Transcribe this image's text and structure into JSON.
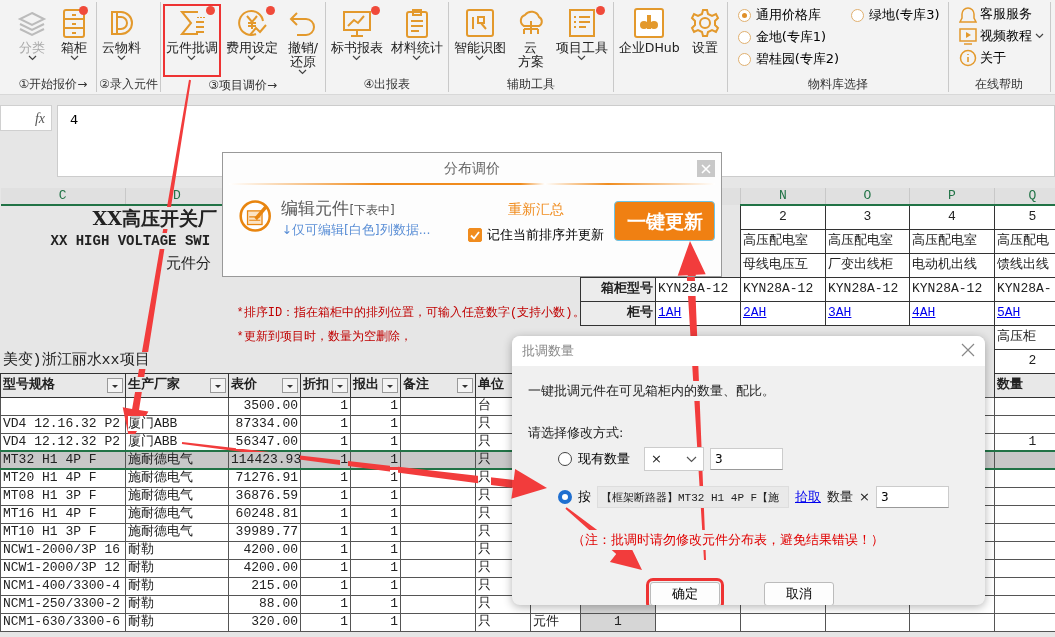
{
  "ribbon": {
    "groups": [
      {
        "kind": "buttons",
        "label": "①开始报价→",
        "buttons": [
          {
            "label": "分类",
            "menu": true,
            "notification": false,
            "disabled": true,
            "highlighted": false
          },
          {
            "label": "箱柜",
            "menu": true,
            "notification": true,
            "disabled": false,
            "highlighted": false
          }
        ]
      },
      {
        "kind": "buttons",
        "label": "②录入元件",
        "buttons": [
          {
            "label": "云物料",
            "menu": true,
            "notification": false,
            "disabled": false,
            "highlighted": false
          }
        ]
      },
      {
        "kind": "buttons",
        "label": "③项目调价→",
        "buttons": [
          {
            "label": "元件批调",
            "menu": true,
            "notification": true,
            "disabled": false,
            "highlighted": true
          },
          {
            "label": "费用设定",
            "menu": true,
            "notification": true,
            "disabled": false,
            "highlighted": false
          },
          {
            "lines": [
              "撤销/",
              "还原"
            ],
            "menu": true,
            "notification": false,
            "disabled": false,
            "highlighted": false
          }
        ]
      },
      {
        "kind": "buttons",
        "label": "④出报表",
        "buttons": [
          {
            "label": "标书报表",
            "menu": true,
            "notification": true,
            "disabled": false,
            "highlighted": false
          },
          {
            "label": "材料统计",
            "menu": true,
            "notification": false,
            "disabled": false,
            "highlighted": false
          }
        ]
      },
      {
        "kind": "buttons",
        "label": "辅助工具",
        "buttons": [
          {
            "label": "智能识图",
            "menu": true,
            "notification": false,
            "disabled": false,
            "highlighted": false
          },
          {
            "lines": [
              "云",
              "方案"
            ],
            "menu": false,
            "notification": false,
            "disabled": false,
            "highlighted": false
          },
          {
            "label": "项目工具",
            "menu": true,
            "notification": true,
            "disabled": false,
            "highlighted": false
          }
        ]
      },
      {
        "kind": "buttons",
        "buttons": [
          {
            "label": "企业DHub",
            "menu": false,
            "notification": false,
            "disabled": false,
            "highlighted": false
          },
          {
            "label": "设置",
            "menu": false,
            "notification": false,
            "disabled": false,
            "highlighted": false
          }
        ]
      },
      {
        "kind": "radios",
        "label": "物料库选择",
        "options": [
          {
            "label": "通用价格库",
            "selected": true
          },
          {
            "label": "金地(专库1)",
            "selected": false
          },
          {
            "label": "碧桂园(专库2)",
            "selected": false
          },
          {
            "label": "绿地(专库3)",
            "selected": false
          }
        ]
      },
      {
        "kind": "links",
        "label": "在线帮助",
        "links": [
          {
            "label": "客服服务",
            "menu": false
          },
          {
            "label": "视频教程",
            "menu": true
          },
          {
            "label": "关于",
            "menu": false
          }
        ]
      }
    ]
  },
  "formula_bar": {
    "function_label": "fx",
    "value": "4"
  },
  "sheet": {
    "column_letters": [
      {
        "letter": "C",
        "selected": true
      },
      {
        "letter": "D",
        "selected": true
      },
      {
        "letter": "N",
        "selected": true
      },
      {
        "letter": "O",
        "selected": true
      },
      {
        "letter": "P",
        "selected": true
      },
      {
        "letter": "Q",
        "selected": true
      }
    ],
    "rows": [
      {
        "kind": "index",
        "banner": {
          "kind": "heading",
          "text": "XX高压开关厂"
        },
        "cells": [
          null,
          null,
          null,
          null,
          null,
          null,
          null,
          null,
          null,
          null,
          "2",
          "3",
          "4",
          "5"
        ]
      },
      {
        "kind": "text",
        "banner": {
          "kind": "subheading",
          "text": "XX HIGH VOLTAGE SWI"
        },
        "cells": [
          null,
          null,
          null,
          null,
          null,
          null,
          null,
          null,
          null,
          null,
          "高压配电室",
          "高压配电室",
          "高压配电室",
          "高压配电"
        ]
      },
      {
        "kind": "text",
        "banner": {
          "kind": "caption",
          "text": "元件分"
        },
        "cells": [
          null,
          null,
          null,
          null,
          null,
          null,
          null,
          null,
          null,
          null,
          "母线电压互",
          "厂变出线柜",
          "电动机出线",
          "馈线出线"
        ]
      },
      {
        "kind": "text",
        "cells": [
          null,
          null,
          null,
          null,
          null,
          null,
          null,
          null,
          "箱柜型号",
          "KYN28A-12",
          "KYN28A-12",
          "KYN28A-12",
          "KYN28A-12",
          "KYN28A-"
        ]
      },
      {
        "kind": "link",
        "banner": {
          "kind": "note",
          "text": "*排序ID：指在箱柜中的排列位置，可输入任意数字(支持小数)。"
        },
        "cells": [
          null,
          null,
          null,
          null,
          null,
          null,
          null,
          null,
          "柜号",
          "1AH",
          "2AH",
          "3AH",
          "4AH",
          "5AH"
        ]
      },
      {
        "kind": "text",
        "banner": {
          "kind": "note",
          "text": "*更新到项目时，数量为空删除，"
        },
        "cells": [
          null,
          null,
          null,
          null,
          null,
          null,
          null,
          null,
          null,
          null,
          null,
          null,
          null,
          "高压柜"
        ]
      },
      {
        "kind": "index",
        "banner": {
          "kind": "project",
          "text": "美变)浙江丽水xx项目"
        },
        "cells": [
          null,
          null,
          null,
          null,
          null,
          null,
          null,
          null,
          null,
          null,
          null,
          null,
          null,
          "2"
        ]
      },
      {
        "kind": "header",
        "filters": [
          true,
          true,
          true,
          true,
          true,
          true
        ],
        "cells": [
          "型号规格",
          "生产厂家",
          "表价",
          "折扣",
          "报出",
          "备注",
          "单位",
          null,
          null,
          null,
          null,
          null,
          null,
          "数量"
        ]
      },
      {
        "kind": "item",
        "selected": false,
        "cells": [
          null,
          null,
          "3500.00",
          "1",
          "1",
          null,
          "台",
          null,
          null,
          null,
          null,
          null,
          null,
          null
        ]
      },
      {
        "kind": "item",
        "selected": false,
        "cells": [
          "VD4 12.16.32 P2",
          "厦门ABB",
          "87334.00",
          "1",
          "1",
          null,
          "只",
          null,
          null,
          null,
          null,
          null,
          null,
          null
        ]
      },
      {
        "kind": "item",
        "selected": false,
        "cells": [
          "VD4 12.12.32 P2",
          "厦门ABB",
          "56347.00",
          "1",
          "1",
          null,
          "只",
          null,
          null,
          null,
          null,
          null,
          null,
          "1"
        ]
      },
      {
        "kind": "item",
        "selected": true,
        "cells": [
          "MT32 H1 4P F",
          "施耐德电气",
          "114423.93",
          "1",
          "1",
          null,
          "只",
          null,
          null,
          null,
          null,
          null,
          null,
          null
        ]
      },
      {
        "kind": "item",
        "selected": false,
        "cells": [
          "MT20 H1 4P F",
          "施耐德电气",
          "71276.91",
          "1",
          "1",
          null,
          "只",
          null,
          null,
          null,
          null,
          null,
          null,
          null
        ]
      },
      {
        "kind": "item",
        "selected": false,
        "cells": [
          "MT08 H1 3P F",
          "施耐德电气",
          "36876.59",
          "1",
          "1",
          null,
          "只",
          null,
          null,
          null,
          null,
          null,
          null,
          null
        ]
      },
      {
        "kind": "item",
        "selected": false,
        "cells": [
          "MT16 H1 4P F",
          "施耐德电气",
          "60248.81",
          "1",
          "1",
          null,
          "只",
          null,
          null,
          null,
          null,
          null,
          null,
          null
        ]
      },
      {
        "kind": "item",
        "selected": false,
        "cells": [
          "MT10 H1 3P F",
          "施耐德电气",
          "39989.77",
          "1",
          "1",
          null,
          "只",
          null,
          null,
          null,
          null,
          null,
          null,
          null
        ]
      },
      {
        "kind": "item",
        "selected": false,
        "cells": [
          "NCW1-2000/3P 16",
          "耐勒",
          "4200.00",
          "1",
          "1",
          null,
          "只",
          null,
          null,
          null,
          null,
          null,
          null,
          null
        ]
      },
      {
        "kind": "item",
        "selected": false,
        "cells": [
          "NCW1-2000/3P 12",
          "耐勒",
          "4200.00",
          "1",
          "1",
          null,
          "只",
          null,
          null,
          null,
          null,
          null,
          null,
          null
        ]
      },
      {
        "kind": "item",
        "selected": false,
        "cells": [
          "NCM1-400/3300-4",
          "耐勒",
          "215.00",
          "1",
          "1",
          null,
          "只",
          null,
          null,
          null,
          null,
          null,
          null,
          null
        ]
      },
      {
        "kind": "item",
        "selected": false,
        "cells": [
          "NCM1-250/3300-2",
          "耐勒",
          "88.00",
          "1",
          "1",
          null,
          "只",
          null,
          null,
          null,
          null,
          null,
          null,
          null
        ]
      },
      {
        "kind": "item",
        "selected": false,
        "cells": [
          "NCM1-630/3300-6",
          "耐勒",
          "320.00",
          "1",
          "1",
          null,
          "只",
          "元件",
          "1",
          null,
          null,
          null,
          null,
          null
        ]
      }
    ]
  },
  "price_dialog": {
    "title": "分布调价",
    "edit_title": "编辑元件",
    "edit_hint": "[下表中]",
    "edit_link": "↓仅可编辑[白色]列数据...",
    "resum_link": "重新汇总",
    "remember": {
      "label": "记住当前排序并更新",
      "checked": true
    },
    "update_button": "一键更新"
  },
  "quantity_dialog": {
    "title": "批调数量",
    "description": "一键批调元件在可见箱柜内的数量、配比。",
    "prompt": "请选择修改方式:",
    "options": [
      {
        "kind": "current",
        "label": "现有数量",
        "selected": false,
        "operator": "×",
        "value": "3"
      },
      {
        "kind": "by_item",
        "label": "按",
        "selected": true,
        "item": "【框架断路器】MT32 H1 4P F【施",
        "pick_link": "拾取",
        "quantity_label": "数量",
        "operator": "×",
        "value": "3"
      }
    ],
    "warning": "（注：批调时请勿修改元件分布表，避免结果错误！）",
    "buttons": [
      {
        "label": "确定",
        "highlighted": true
      },
      {
        "label": "取消",
        "highlighted": false
      }
    ]
  }
}
